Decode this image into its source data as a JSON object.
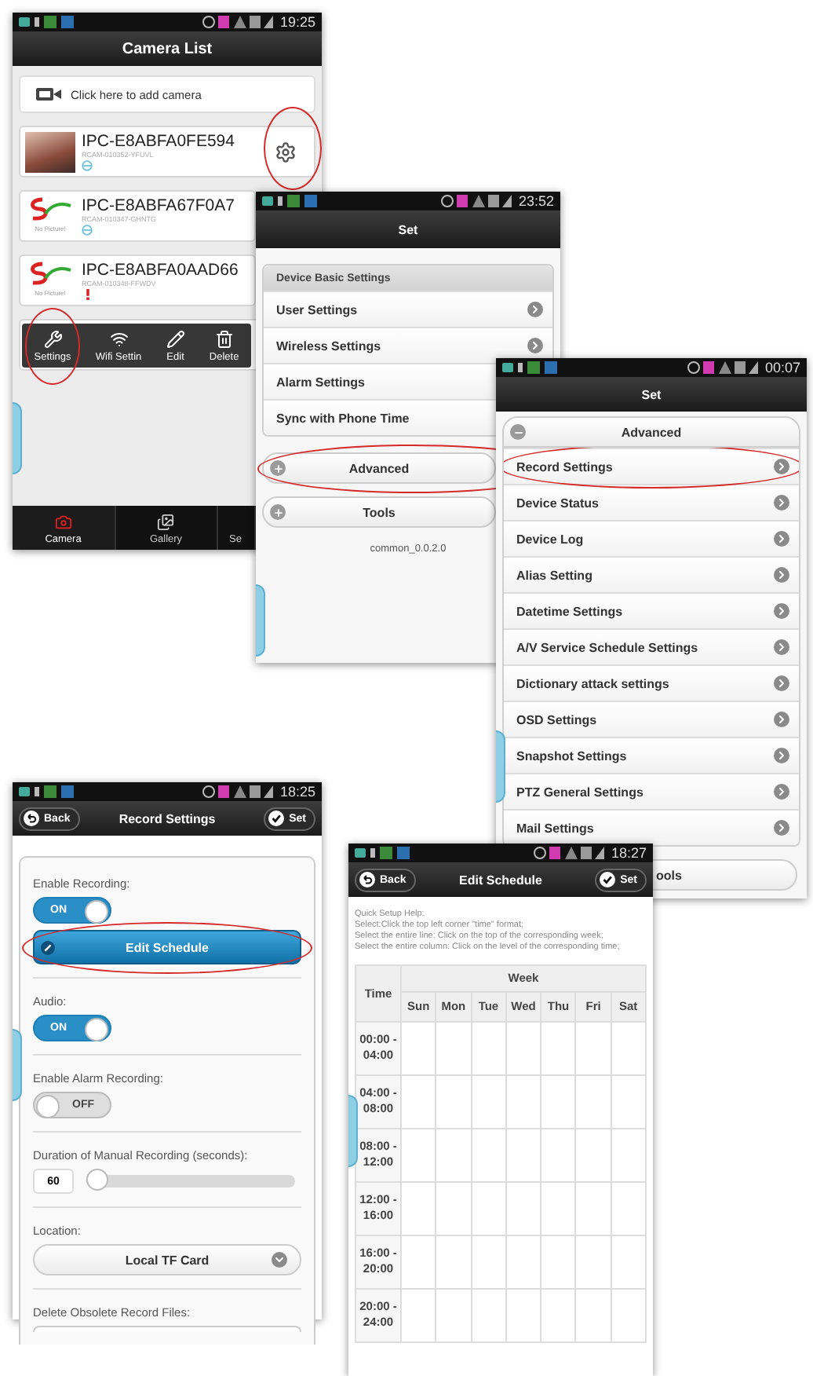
{
  "screens": [
    {
      "kind": "camera_list",
      "time": "19:25",
      "title": "Camera List",
      "add_camera": "Click here to add camera",
      "cameras": [
        {
          "name": "IPC-E8ABFA0FE594",
          "code": "RCAM-010352-YFUVL",
          "has_photo": true,
          "alert": false,
          "settings_icon": true,
          "circled": true
        },
        {
          "name": "IPC-E8ABFA67F0A7",
          "code": "RCAM-010347-GHNTG",
          "has_photo": false,
          "caption": "No Picture!",
          "alert": false,
          "settings_icon": false,
          "circled": false
        },
        {
          "name": "IPC-E8ABFA0AAD66",
          "code": "RCAM-010348-FFWDV",
          "has_photo": false,
          "caption": "No Picture!",
          "alert": true,
          "settings_icon": false,
          "circled": false
        }
      ],
      "context_menu": [
        {
          "kind": "settings",
          "label": "Settings",
          "circled": true
        },
        {
          "kind": "wifi",
          "label": "Wifi Settin",
          "circled": false
        },
        {
          "kind": "edit",
          "label": "Edit",
          "circled": false
        },
        {
          "kind": "delete",
          "label": "Delete",
          "circled": false
        }
      ],
      "tabs": [
        {
          "kind": "camera",
          "label": "Camera",
          "selected": true
        },
        {
          "kind": "gallery",
          "label": "Gallery",
          "selected": false
        },
        {
          "kind": "settings",
          "label": "Se",
          "selected": false
        }
      ]
    },
    {
      "kind": "settings_menu",
      "time": "23:52",
      "title": "Set",
      "blocks": [
        {
          "kind": "group",
          "header": "Device Basic Settings",
          "items": [
            {
              "label": "User Settings",
              "arrow": true,
              "circled": false
            },
            {
              "label": "Wireless Settings",
              "arrow": true,
              "circled": false
            },
            {
              "label": "Alarm Settings",
              "arrow": false,
              "circled": false
            },
            {
              "label": "Sync with Phone Time",
              "arrow": false,
              "circled": false
            }
          ]
        },
        {
          "kind": "section",
          "label": "Advanced",
          "expanded": false,
          "circled": true,
          "partial": false
        },
        {
          "kind": "section",
          "label": "Tools",
          "expanded": false,
          "circled": false,
          "partial": false
        },
        {
          "kind": "note",
          "text": "common_0.0.2.0"
        }
      ]
    },
    {
      "kind": "settings_menu",
      "time": "00:07",
      "title": "Set",
      "blocks": [
        {
          "kind": "section",
          "label": "Advanced",
          "expanded": true,
          "circled": false,
          "partial": false,
          "items": [
            {
              "label": "Record Settings",
              "arrow": true,
              "circled": true
            },
            {
              "label": "Device Status",
              "arrow": true,
              "circled": false
            },
            {
              "label": "Device Log",
              "arrow": true,
              "circled": false
            },
            {
              "label": "Alias Setting",
              "arrow": true,
              "circled": false
            },
            {
              "label": "Datetime Settings",
              "arrow": true,
              "circled": false
            },
            {
              "label": "A/V Service Schedule Settings",
              "arrow": true,
              "circled": false
            },
            {
              "label": "Dictionary attack settings",
              "arrow": true,
              "circled": false
            },
            {
              "label": "OSD Settings",
              "arrow": true,
              "circled": false
            },
            {
              "label": "Snapshot Settings",
              "arrow": true,
              "circled": false
            },
            {
              "label": "PTZ General Settings",
              "arrow": true,
              "circled": false
            },
            {
              "label": "Mail Settings",
              "arrow": true,
              "circled": false
            }
          ]
        },
        {
          "kind": "section",
          "label": "ools",
          "expanded": false,
          "circled": false,
          "partial": true
        }
      ]
    },
    {
      "kind": "record_settings",
      "time": "18:25",
      "back": "Back",
      "title": "Record Settings",
      "action": "Set",
      "fields": [
        {
          "label": "Enable Recording:",
          "controls": [
            {
              "kind": "toggle",
              "on": true,
              "text": "ON"
            },
            {
              "kind": "button",
              "text": "Edit Schedule",
              "circled": true
            }
          ]
        },
        {
          "label": "Audio:",
          "controls": [
            {
              "kind": "toggle",
              "on": true,
              "text": "ON"
            }
          ]
        },
        {
          "label": "Enable Alarm Recording:",
          "controls": [
            {
              "kind": "toggle",
              "on": false,
              "text": "OFF"
            }
          ]
        },
        {
          "label": "Duration of Manual Recording (seconds):",
          "controls": [
            {
              "kind": "slider",
              "value": "60",
              "level": 0
            }
          ]
        },
        {
          "label": "Location:",
          "controls": [
            {
              "kind": "select",
              "value": "Local TF Card"
            }
          ]
        },
        {
          "label": "Delete Obsolete Record Files:",
          "controls": [
            {
              "kind": "select_partial"
            }
          ]
        }
      ]
    },
    {
      "kind": "schedule",
      "time": "18:27",
      "back": "Back",
      "title": "Edit Schedule",
      "action": "Set",
      "help": [
        "Quick Setup Help:",
        "Select:Click the top left corner \"time\" format;",
        "Select the entire line: Click on the top of the corresponding week;",
        "Select the entire column: Click on the level of the corresponding time;"
      ],
      "table": {
        "corner": "Time",
        "group": "Week",
        "columns": [
          "Sun",
          "Mon",
          "Tue",
          "Wed",
          "Thu",
          "Fri",
          "Sat"
        ],
        "rows": [
          "00:00 - 04:00",
          "04:00 - 08:00",
          "08:00 - 12:00",
          "12:00 - 16:00",
          "16:00 - 20:00",
          "20:00 - 24:00"
        ]
      }
    }
  ]
}
